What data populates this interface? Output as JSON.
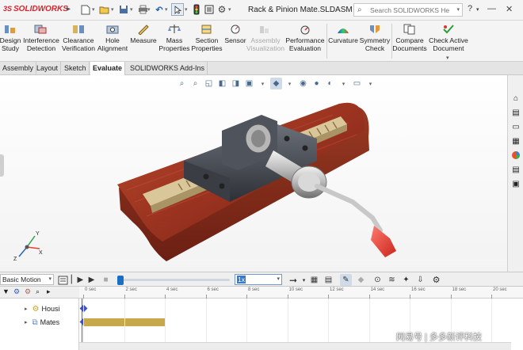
{
  "app": {
    "logo_prefix": "3S",
    "logo_text": "SOLIDWORKS",
    "document_title": "Rack & Pinion Mate.SLDASM *"
  },
  "search": {
    "placeholder": "Search SOLIDWORKS Help"
  },
  "quick_access": {
    "icons": [
      "new-document-icon",
      "open-icon",
      "save-icon",
      "print-icon",
      "undo-icon",
      "select-icon",
      "rebuild-icon",
      "file-properties-icon",
      "options-icon"
    ]
  },
  "window_controls": {
    "help": "?",
    "minimize": "—",
    "close": "✕"
  },
  "ribbon": {
    "items": [
      {
        "label": "Design\nStudy",
        "icon": "design-study-icon"
      },
      {
        "label": "Interference\nDetection",
        "icon": "interference-detection-icon"
      },
      {
        "label": "Clearance\nVerification",
        "icon": "clearance-verification-icon"
      },
      {
        "label": "Hole\nAlignment",
        "icon": "hole-alignment-icon"
      },
      {
        "label": "Measure",
        "icon": "measure-icon"
      },
      {
        "label": "Mass\nProperties",
        "icon": "mass-properties-icon"
      },
      {
        "label": "Section\nProperties",
        "icon": "section-properties-icon"
      },
      {
        "label": "Sensor",
        "icon": "sensor-icon"
      },
      {
        "label": "Assembly\nVisualization",
        "icon": "assembly-visualization-icon",
        "disabled": true
      },
      {
        "label": "Performance\nEvaluation",
        "icon": "performance-evaluation-icon"
      },
      {
        "label": "Curvature",
        "icon": "curvature-icon"
      },
      {
        "label": "Symmetry\nCheck",
        "icon": "symmetry-check-icon"
      },
      {
        "label": "Compare\nDocuments",
        "icon": "compare-documents-icon"
      },
      {
        "label": "Check Active\nDocument",
        "icon": "check-active-document-icon"
      }
    ]
  },
  "tabs": [
    {
      "label": "Assembly"
    },
    {
      "label": "Layout"
    },
    {
      "label": "Sketch"
    },
    {
      "label": "Evaluate",
      "active": true
    },
    {
      "label": "SOLIDWORKS Add-Ins"
    }
  ],
  "triad": {
    "x": "X",
    "y": "Y",
    "z": "Z"
  },
  "motion": {
    "study_type": "Basic Motion",
    "playback_speed": "1x",
    "playhead_fraction": 0.02
  },
  "timeline": {
    "ticks": [
      "0 sec",
      "2 sec",
      "4 sec",
      "6 sec",
      "8 sec",
      "10 sec",
      "12 sec",
      "14 sec",
      "16 sec",
      "18 sec",
      "20 sec"
    ],
    "tree": [
      {
        "label": "Housi",
        "icon": "assembly-component-icon"
      },
      {
        "label": "Mates",
        "icon": "mates-folder-icon"
      }
    ],
    "mates_bar_end_sec": 4
  },
  "watermark": "网易号 | 多多新评科技"
}
